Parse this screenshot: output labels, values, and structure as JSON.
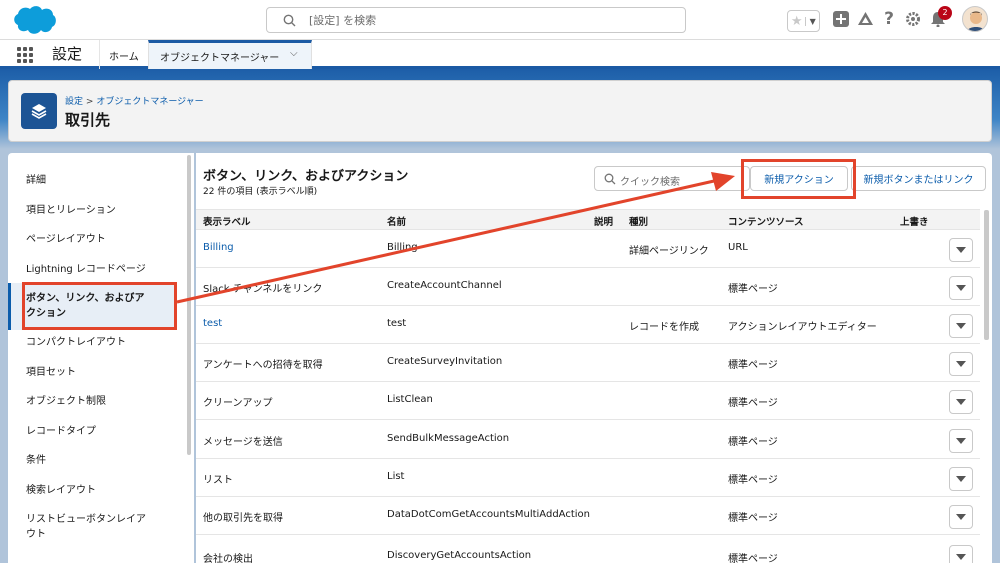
{
  "header": {
    "search_placeholder": "[設定] を検索",
    "notification_count": "2"
  },
  "app_nav": {
    "app_name": "設定",
    "home_tab": "ホーム",
    "active_tab": "オブジェクトマネージャー"
  },
  "page_header": {
    "breadcrumb_root": "設定",
    "breadcrumb_sep": ">",
    "breadcrumb_child": "オブジェクトマネージャー",
    "title": "取引先"
  },
  "sidebar": {
    "items": [
      {
        "label": "詳細"
      },
      {
        "label": "項目とリレーション"
      },
      {
        "label": "ページレイアウト"
      },
      {
        "label": "Lightning レコードページ"
      },
      {
        "label": "ボタン、リンク、およびアクション"
      },
      {
        "label": "コンパクトレイアウト"
      },
      {
        "label": "項目セット"
      },
      {
        "label": "オブジェクト制限"
      },
      {
        "label": "レコードタイプ"
      },
      {
        "label": "条件"
      },
      {
        "label": "検索レイアウト"
      },
      {
        "label": "リストビューボタンレイアウト"
      }
    ],
    "active_line1": "ボタン、リンク、およびア",
    "active_line2": "クション",
    "last_line1": "リストビューボタンレイア",
    "last_line2": "ウト"
  },
  "main": {
    "title": "ボタン、リンク、およびアクション",
    "subtitle": "22 件の項目 (表示ラベル順)",
    "quick_search_placeholder": "クイック検索",
    "new_action_button": "新規アクション",
    "new_button_link_button": "新規ボタンまたはリンク"
  },
  "table": {
    "columns": {
      "label": "表示ラベル",
      "name": "名前",
      "description": "説明",
      "type": "種別",
      "content_source": "コンテンツソース",
      "override": "上書き"
    },
    "rows": [
      {
        "label": "Billing",
        "name": "Billing",
        "type": "詳細ページリンク",
        "source": "URL"
      },
      {
        "label": "Slack チャンネルをリンク",
        "name": "CreateAccountChannel",
        "type": "",
        "source": "標準ページ"
      },
      {
        "label": "test",
        "name": "test",
        "type": "レコードを作成",
        "source": "アクションレイアウトエディター"
      },
      {
        "label": "アンケートへの招待を取得",
        "name": "CreateSurveyInvitation",
        "type": "",
        "source": "標準ページ"
      },
      {
        "label": "クリーンアップ",
        "name": "ListClean",
        "type": "",
        "source": "標準ページ"
      },
      {
        "label": "メッセージを送信",
        "name": "SendBulkMessageAction",
        "type": "",
        "source": "標準ページ"
      },
      {
        "label": "リスト",
        "name": "List",
        "type": "",
        "source": "標準ページ"
      },
      {
        "label": "他の取引先を取得",
        "name": "DataDotComGetAccountsMultiAddAction",
        "type": "",
        "source": "標準ページ"
      },
      {
        "label": "会社の検出",
        "name": "DiscoveryGetAccountsAction",
        "type": "",
        "source": "標準ページ"
      }
    ]
  },
  "colors": {
    "brand_blue": "#0b5cab",
    "nav_accent": "#1b5aa4",
    "highlight_red": "#e2442b"
  }
}
